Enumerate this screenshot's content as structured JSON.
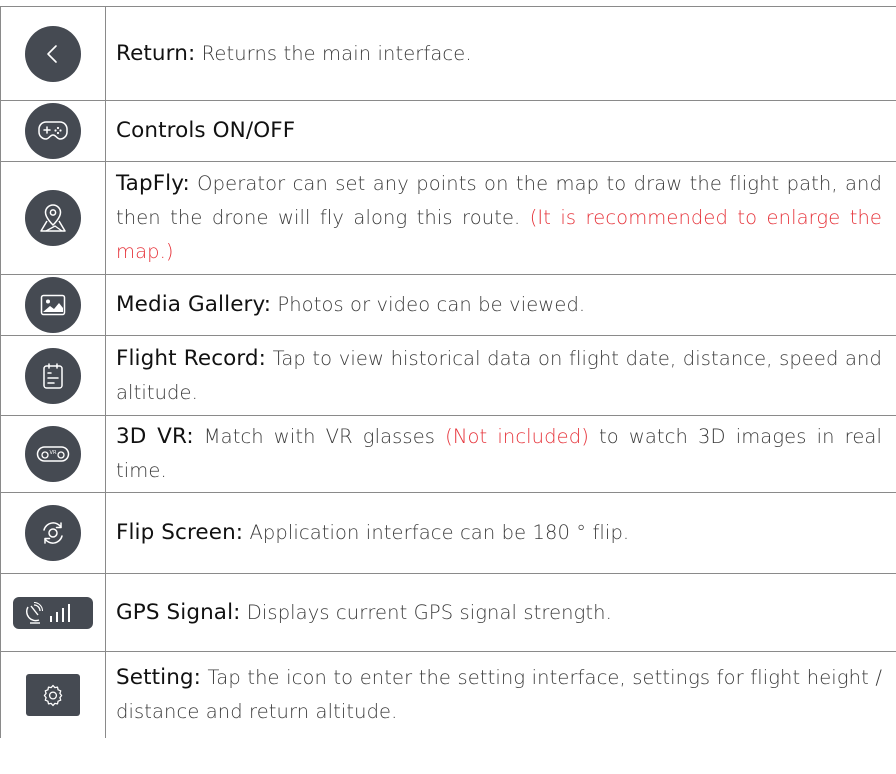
{
  "rows": [
    {
      "icon": "back-chevron-icon",
      "title": "Return:",
      "desc": " Returns the main interface.",
      "note": "",
      "after": ""
    },
    {
      "icon": "gamepad-icon",
      "title": "Controls ON/OFF",
      "desc": "",
      "note": "",
      "after": ""
    },
    {
      "icon": "map-pin-icon",
      "title": "TapFly:",
      "desc": " Operator can set any points on the map to draw the flight path, and then the drone will fly along this route.  ",
      "note": "(It is recommended to enlarge the map.)",
      "after": ""
    },
    {
      "icon": "image-icon",
      "title": "Media Gallery:",
      "desc": " Photos or video can be viewed.",
      "note": "",
      "after": ""
    },
    {
      "icon": "clipboard-icon",
      "title": "Flight Record:",
      "desc": " Tap to view historical data on flight date, distance, speed and altitude.",
      "note": "",
      "after": ""
    },
    {
      "icon": "vr-glasses-icon",
      "title": "3D VR:",
      "desc": " Match with VR glasses ",
      "note": "(Not included)",
      "after": " to watch 3D images in real time."
    },
    {
      "icon": "flip-screen-icon",
      "title": "Flip Screen:",
      "desc": " Application interface can be 180 ° flip.",
      "note": "",
      "after": ""
    },
    {
      "icon": "gps-signal-icon",
      "title": "GPS Signal:",
      "desc": " Displays current GPS signal strength.",
      "note": "",
      "after": ""
    },
    {
      "icon": "settings-gear-icon",
      "title": "Setting:",
      "desc": " Tap the icon to enter the setting interface, settings for flight height / distance and return altitude.",
      "note": "",
      "after": ""
    }
  ],
  "colors": {
    "icon_bg": "#454a52",
    "note_red": "#e6333a",
    "border": "#8a8a8a"
  }
}
